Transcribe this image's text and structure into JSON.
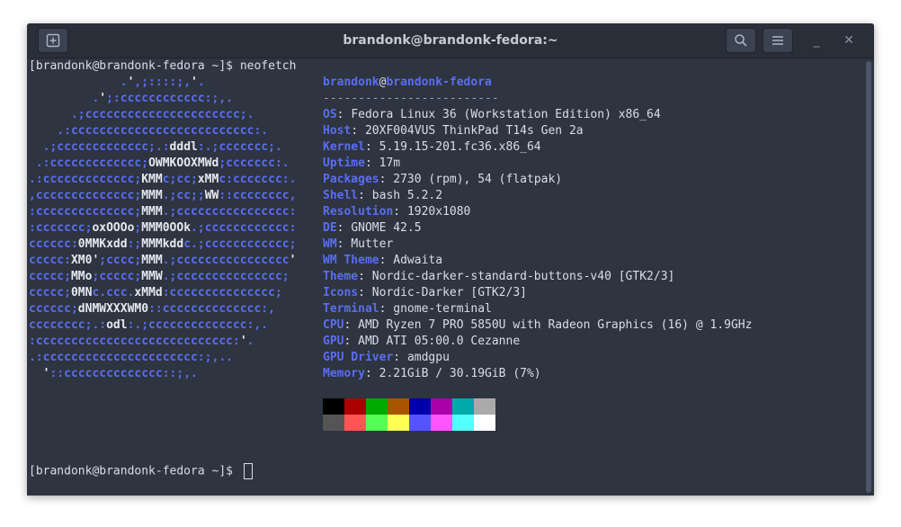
{
  "window": {
    "title": "brandonk@brandonk-fedora:~"
  },
  "icons": {
    "new_tab": "new-tab-icon",
    "search": "search-icon",
    "menu": "hamburger-menu-icon",
    "minimize": "minimize-icon",
    "close": "close-icon"
  },
  "titlebar_glyphs": {
    "minimize": "_",
    "close": "✕"
  },
  "terminal": {
    "prompt": "[brandonk@brandonk-fedora ~]$ ",
    "command": "neofetch",
    "final_prompt": "[brandonk@brandonk-fedora ~]$ "
  },
  "logo": [
    "             .',;::::;,'.",
    "         .';:cccccccccccc:;,.",
    "      .;cccccccccccccccccccccc;.",
    "    .:cccccccccccccccccccccccccc:.",
    "  .;ccccccccccccc;.:dddl:.;ccccccc;.",
    " .:ccccccccccccc;OWMKOOXMWd;ccccccc:.",
    ".:ccccccccccccc;KMMc;cc;xMMc:ccccccc:.",
    ",cccccccccccccc;MMM.;cc;;WW::cccccccc,",
    ":cccccccccccccc;MMM.;cccccccccccccccc:",
    ":ccccccc;oxOOOo;MMM0OOk.;cccccccccccc:",
    "cccccc:0MMKxdd:;MMMkddc.;cccccccccccc;",
    "ccccc:XM0';cccc;MMM.;cccccccccccccccc'",
    "ccccc;MMo;ccccc;MMW.;ccccccccccccccc;",
    "ccccc;0MNc.ccc.xMMd:ccccccccccccccc;",
    "cccccc;dNMWXXXWM0::cccccccccccccc:,",
    "cccccccc;.:odl:.;cccccccccccccc:,.",
    ":cccccccccccccccccccccccccccc:'.",
    ".:cccccccccccccccccccccc:;,..",
    "  '::cccccccccccccc::;,."
  ],
  "header": {
    "user": "brandonk",
    "at": "@",
    "host": "brandonk-fedora",
    "separator": "-------------------------"
  },
  "info": [
    {
      "key": "OS",
      "value": "Fedora Linux 36 (Workstation Edition) x86_64"
    },
    {
      "key": "Host",
      "value": "20XF004VUS ThinkPad T14s Gen 2a"
    },
    {
      "key": "Kernel",
      "value": "5.19.15-201.fc36.x86_64"
    },
    {
      "key": "Uptime",
      "value": "17m"
    },
    {
      "key": "Packages",
      "value": "2730 (rpm), 54 (flatpak)"
    },
    {
      "key": "Shell",
      "value": "bash 5.2.2"
    },
    {
      "key": "Resolution",
      "value": "1920x1080"
    },
    {
      "key": "DE",
      "value": "GNOME 42.5"
    },
    {
      "key": "WM",
      "value": "Mutter"
    },
    {
      "key": "WM Theme",
      "value": "Adwaita"
    },
    {
      "key": "Theme",
      "value": "Nordic-darker-standard-buttons-v40 [GTK2/3]"
    },
    {
      "key": "Icons",
      "value": "Nordic-Darker [GTK2/3]"
    },
    {
      "key": "Terminal",
      "value": "gnome-terminal"
    },
    {
      "key": "CPU",
      "value": "AMD Ryzen 7 PRO 5850U with Radeon Graphics (16) @ 1.9GHz"
    },
    {
      "key": "GPU",
      "value": "AMD ATI 05:00.0 Cezanne"
    },
    {
      "key": "GPU Driver",
      "value": "amdgpu"
    },
    {
      "key": "Memory",
      "value": "2.21GiB / 30.19GiB (7%)"
    }
  ],
  "palette": {
    "normal": [
      "#000000",
      "#aa0000",
      "#00aa00",
      "#aa5500",
      "#0000aa",
      "#aa00aa",
      "#00aaaa",
      "#aaaaaa"
    ],
    "bright": [
      "#555555",
      "#ff5555",
      "#55ff55",
      "#ffff55",
      "#5555ff",
      "#ff55ff",
      "#55ffff",
      "#ffffff"
    ]
  },
  "colors": {
    "accent": "#5a6ef0",
    "background": "#2e3440",
    "text": "#d8dee9"
  }
}
